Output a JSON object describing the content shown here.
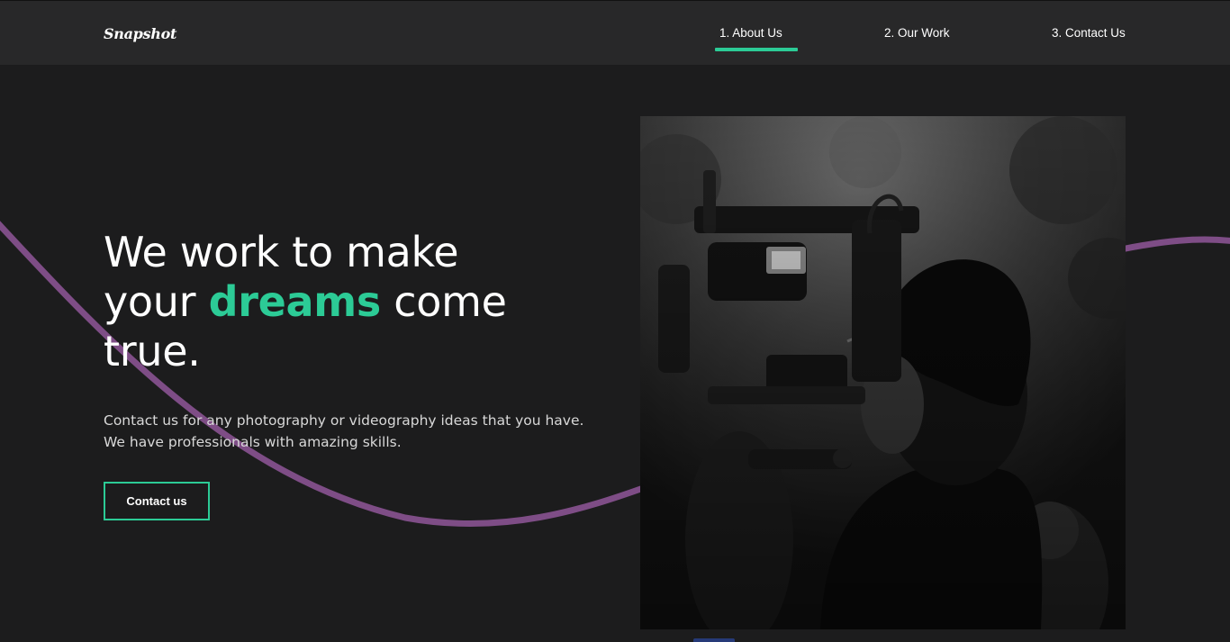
{
  "header": {
    "logo": "Snapshot",
    "nav": [
      {
        "label": "1. About Us",
        "active": true
      },
      {
        "label": "2. Our Work",
        "active": false
      },
      {
        "label": "3. Contact Us",
        "active": false
      }
    ]
  },
  "hero": {
    "heading_line1": "We work to make",
    "heading_prefix": "your ",
    "heading_accent": "dreams",
    "heading_suffix": " come",
    "heading_line3": "true.",
    "description_line1": "Contact us for any photography or videography ideas that you have.",
    "description_line2": "We have professionals with amazing skills.",
    "cta_label": "Contact us"
  },
  "colors": {
    "background": "#1c1c1d",
    "navbar": "#282829",
    "accent": "#2ccb96",
    "wave": "#7e4d86"
  },
  "icons": {
    "photo": "videographer-photo"
  }
}
